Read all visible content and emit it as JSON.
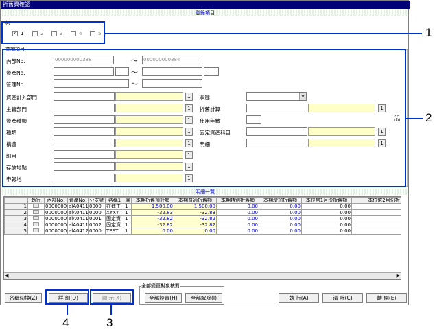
{
  "window": {
    "title": "折舊費確認"
  },
  "sections": {
    "display_items": "登錄項目",
    "query_items": "查詢項目",
    "detail_list": "明細一覽"
  },
  "ledger": {
    "label": "帳",
    "options": [
      {
        "label": "1",
        "checked": true
      },
      {
        "label": "2",
        "checked": false
      },
      {
        "label": "3",
        "checked": false
      },
      {
        "label": "4",
        "checked": false
      },
      {
        "label": "5",
        "checked": false
      }
    ]
  },
  "query": {
    "internal_no_label": "內部No.",
    "internal_no_from": "000000000388",
    "internal_no_to": "000000000384",
    "asset_no_label": "資產No.",
    "mgmt_no_label": "管理No.",
    "tilde": "〜",
    "asset_dept_label": "資產計入部門",
    "main_dept_label": "主管部門",
    "asset_type_label": "資產種類",
    "kind_label": "種類",
    "structure_label": "構造",
    "detail_label": "細目",
    "location_label": "存放地點",
    "report_label": "申報地",
    "status_label": "狀態",
    "depr_calc_label": "折舊計算",
    "life_label": "使用年數",
    "fixed_asset_label": "固定資產科目",
    "spec_label": "明細",
    "btn_1": "1",
    "expand": "»» (D)"
  },
  "table": {
    "headers": [
      "執行",
      "內部No.",
      "資產No.",
      "分支號",
      "名稱1",
      "層",
      "本期折舊預計額",
      "本期普通折舊額",
      "本期特別折舊額",
      "本期增加折舊額",
      "本位幣1月份折舊額",
      "本位幣2月份折"
    ],
    "rows": [
      {
        "row_no": "1",
        "internal_no": "00000000(",
        "asset_no": "alA0411C",
        "branch": "0000",
        "name": "在建工",
        "layer": "1",
        "plan": "1,500.00",
        "normal": "1,500.00",
        "special": "0.00",
        "increase": "0.00",
        "m1": "0.00"
      },
      {
        "row_no": "2",
        "internal_no": "00000000(",
        "asset_no": "alA0411C",
        "branch": "0000",
        "name": "XYXY",
        "layer": "1",
        "plan": "-32.83",
        "normal": "-32.83",
        "special": "0.00",
        "increase": "0.00",
        "m1": "0.00"
      },
      {
        "row_no": "3",
        "internal_no": "00000000(",
        "asset_no": "alA0411C",
        "branch": "0001",
        "name": "固定資",
        "layer": "1",
        "plan": "-32.82",
        "normal": "-32.82",
        "special": "0.00",
        "increase": "0.00",
        "m1": "0.00"
      },
      {
        "row_no": "4",
        "internal_no": "00000000(",
        "asset_no": "alA0411C",
        "branch": "0002",
        "name": "固定資",
        "layer": "1",
        "plan": "-32.82",
        "normal": "-32.82",
        "special": "0.00",
        "increase": "0.00",
        "m1": "0.00"
      },
      {
        "row_no": "5",
        "internal_no": "00000000(",
        "asset_no": "alA0412C",
        "branch": "0000",
        "name": "TEST",
        "layer": "1",
        "plan": "0.00",
        "normal": "0.00",
        "special": "0.00",
        "increase": "0.00",
        "m1": "0.00"
      }
    ]
  },
  "bottom": {
    "group_label": "全部變更對象核對",
    "switch_name": "名稱切換(Z)",
    "detail": "詳 細(D)",
    "display": "顯 示(X)",
    "select_all": "全部設置(H)",
    "clear_all": "全部解除(I)",
    "execute": "執 行(A)",
    "clear": "清 除(C)",
    "close": "離 開(E)"
  },
  "callouts": {
    "c1": "1",
    "c2": "2",
    "c3": "3",
    "c4": "4"
  },
  "colors": {
    "callout": "#0030d0",
    "titlebar": "#000078",
    "yellow_field": "#ffffc8"
  }
}
